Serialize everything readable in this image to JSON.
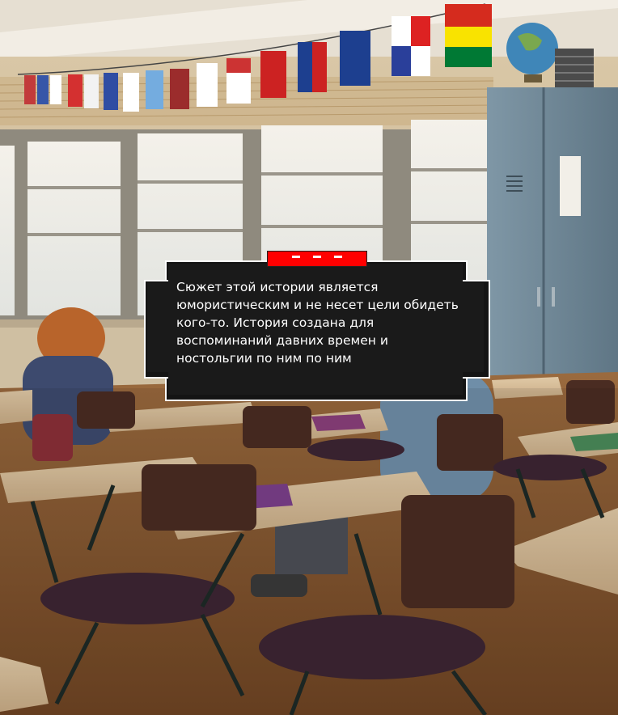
{
  "dialog": {
    "text": "Сюжет этой истории является юмористическим и не несет цели обидеть кого-то. История создана для воспоминаний давних времен и ностольгии по ним по ним",
    "speaker_tab_color": "#ff0000"
  },
  "scene": {
    "setting": "classroom"
  },
  "colors": {
    "dialog_bg": "#1a1a1a",
    "dialog_border": "#ffffff",
    "dialog_text": "#ffffff"
  }
}
